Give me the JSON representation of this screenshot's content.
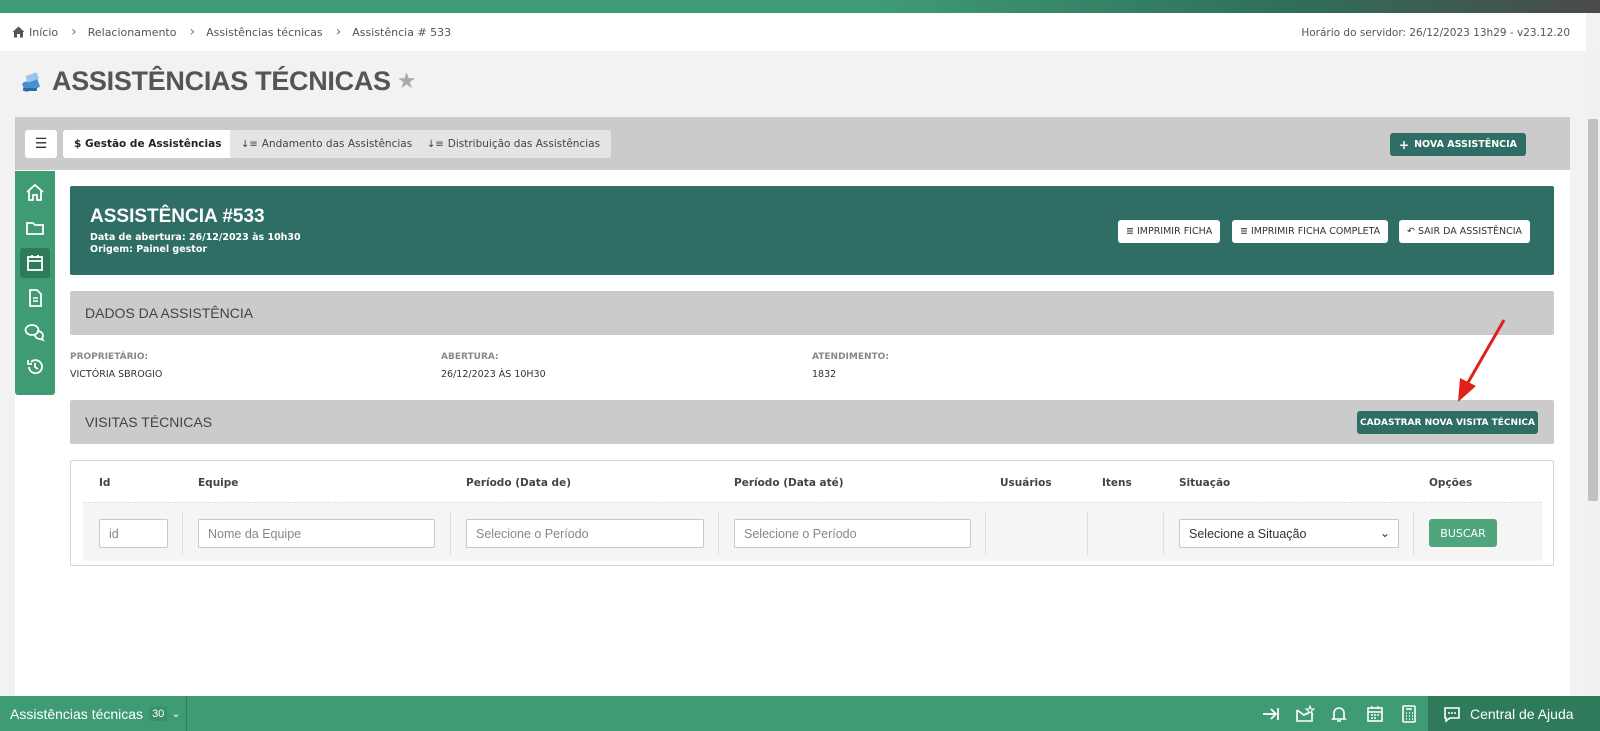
{
  "breadcrumb": [
    {
      "label": "Início"
    },
    {
      "label": "Relacionamento"
    },
    {
      "label": "Assistências técnicas"
    },
    {
      "label": "Assistência # 533"
    }
  ],
  "server_time": "Horário do servidor: 26/12/2023 13h29 - v23.12.20",
  "page_title": "ASSISTÊNCIAS TÉCNICAS",
  "tabs": {
    "menu_glyph": "☰",
    "gestao": "$ Gestão de Assistências",
    "andamento": "Andamento das Assistências",
    "distribuicao": "Distribuição das Assistências",
    "new_button": "NOVA ASSISTÊNCIA"
  },
  "side_nav": [
    "home-icon",
    "folder-icon",
    "calendar-icon",
    "document-icon",
    "chat-icon",
    "history-icon"
  ],
  "hero": {
    "title": "ASSISTÊNCIA #533",
    "opened": "Data de abertura: 26/12/2023 às 10h30",
    "origin": "Origem: Painel gestor",
    "btn_print": "IMPRIMIR FICHA",
    "btn_print_full": "IMPRIMIR FICHA COMPLETA",
    "btn_exit": "SAIR DA ASSISTÊNCIA"
  },
  "dados": {
    "header": "DADOS DA ASSISTÊNCIA",
    "owner_label": "PROPRIETÁRIO:",
    "owner_value": "VICTÓRIA SBROGIO",
    "opening_label": "ABERTURA:",
    "opening_value": "26/12/2023 ÀS 10H30",
    "service_label": "ATENDIMENTO:",
    "service_value": "1832"
  },
  "visitas": {
    "header": "VISITAS TÉCNICAS",
    "new_visit_button": "CADASTRAR NOVA VISITA TÉCNICA",
    "columns": [
      "Id",
      "Equipe",
      "Período (Data de)",
      "Período (Data até)",
      "Usuários",
      "Itens",
      "Situação",
      "Opções"
    ],
    "filters": {
      "id_placeholder": "id",
      "team_placeholder": "Nome da Equipe",
      "from_placeholder": "Selecione o Período",
      "to_placeholder": "Selecione o Período",
      "status_selected": "Selecione a Situação",
      "search_button": "BUSCAR"
    }
  },
  "bottom_bar": {
    "module": "Assistências técnicas",
    "count": "30",
    "help": "Central de Ajuda"
  },
  "colors": {
    "primary_green": "#3e9b73",
    "dark_teal": "#2e6e64",
    "annotation_arrow": "#e0201b"
  }
}
